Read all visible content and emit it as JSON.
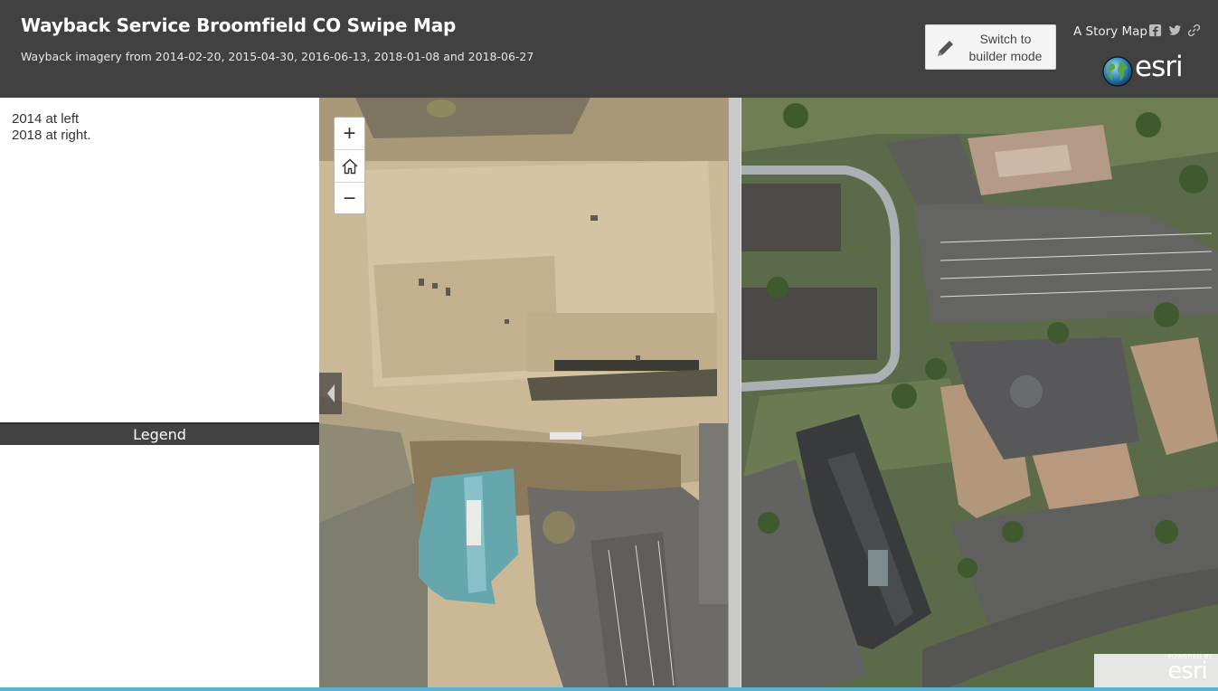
{
  "header": {
    "title": "Wayback Service Broomfield CO Swipe Map",
    "subtitle": "Wayback imagery from 2014-02-20, 2015-04-30, 2016-06-13, 2018-01-08 and 2018-06-27",
    "builder_button": {
      "line1": "Switch to",
      "line2": "builder mode",
      "icon": "pencil-icon"
    },
    "story_map_link": "A Story Map",
    "social_icons": [
      "facebook-icon",
      "twitter-icon",
      "link-icon"
    ],
    "logo_text": "esri"
  },
  "side_panel": {
    "description": [
      "2014 at left",
      "2018 at right."
    ],
    "legend_label": "Legend"
  },
  "map": {
    "zoom_in_label": "+",
    "zoom_out_label": "−",
    "home_icon": "home-icon",
    "collapse_icon": "chevron-left-icon",
    "powered_by": "POWERED BY",
    "powered_logo": "esri"
  },
  "colors": {
    "header_bg": "#414141",
    "legend_bg": "#424242",
    "accent_strip": "#5ab2cf",
    "button_bg": "#f4f4f4"
  }
}
